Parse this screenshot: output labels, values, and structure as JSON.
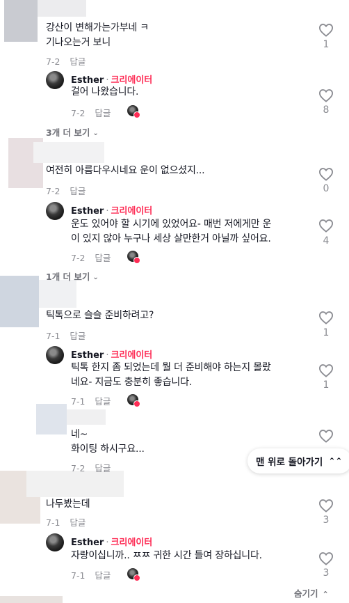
{
  "comments": [
    {
      "text_lines": [
        "강산이 변해가는가부네 ㅋ",
        "기나오는거 보니"
      ],
      "date": "7-2",
      "reply": "답글",
      "likes": "1",
      "reply_item": {
        "author": "Esther",
        "sep": "·",
        "badge": "크리에이터",
        "text_lines": [
          "걸어 나왔습니다."
        ],
        "date": "7-2",
        "reply": "답글",
        "likes": "8"
      },
      "more": "3개 더 보기"
    },
    {
      "text_lines": [
        "여전히 아름다우시네요 운이 없으셨지..."
      ],
      "date": "7-2",
      "reply": "답글",
      "likes": "0",
      "reply_item": {
        "author": "Esther",
        "sep": "·",
        "badge": "크리에이터",
        "text_lines": [
          "운도 있어야 할 시기에 있었어요- 매번 저에게만 운",
          "이 있지 않아 누구나 세상 살만한거 아닐까 싶어요."
        ],
        "date": "7-2",
        "reply": "답글",
        "likes": "4"
      },
      "more": "1개 더 보기"
    },
    {
      "text_lines": [
        "틱톡으로 슬슬 준비하려고?"
      ],
      "date": "7-1",
      "reply": "답글",
      "likes": "1",
      "reply_item": {
        "author": "Esther",
        "sep": "·",
        "badge": "크리에이터",
        "text_lines": [
          "틱톡 한지 좀 되었는데 뭘 더 준비해야 하는지 몰랐",
          "네요- 지금도 충분히 좋습니다."
        ],
        "date": "7-1",
        "reply": "답글",
        "likes": "1"
      }
    },
    {
      "text_lines": [
        "네~",
        "화이팅 하시구요..."
      ],
      "date": "7-2",
      "reply": "답글",
      "likes": ""
    },
    {
      "text_lines": [
        "나두봤는데"
      ],
      "date": "7-1",
      "reply": "답글",
      "likes": "3",
      "reply_item": {
        "author": "Esther",
        "sep": "·",
        "badge": "크리에이터",
        "text_lines": [
          "자랑이십니까.. ㅉㅉ 귀한 시간 들여 장하십니다."
        ],
        "date": "7-1",
        "reply": "답글",
        "likes": "3"
      }
    }
  ],
  "scroll_top_label": "맨 위로 돌아가기",
  "scroll_top_icon": "double-chevron-up-icon",
  "hide_label": "숨기기",
  "hide_icon": "chevron-up-icon",
  "colors": {
    "creator_badge": "#fe2c55",
    "meta_gray": "#8a8b91",
    "text": "#161823"
  }
}
